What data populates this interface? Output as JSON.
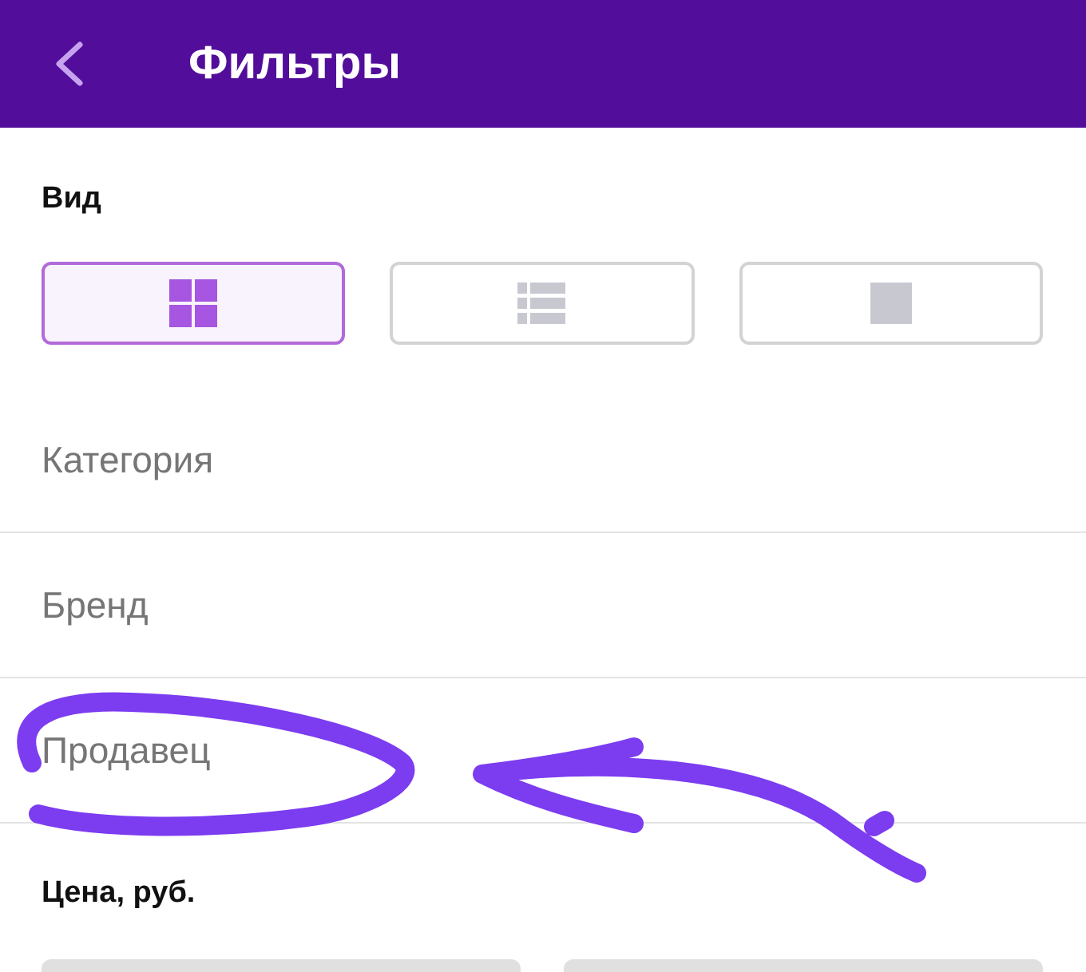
{
  "header": {
    "title": "Фильтры"
  },
  "view": {
    "label": "Вид",
    "options": [
      {
        "kind": "grid",
        "selected": true
      },
      {
        "kind": "list",
        "selected": false
      },
      {
        "kind": "single",
        "selected": false
      }
    ]
  },
  "filters": [
    "Категория",
    "Бренд",
    "Продавец"
  ],
  "price": {
    "label": "Цена, руб."
  }
}
